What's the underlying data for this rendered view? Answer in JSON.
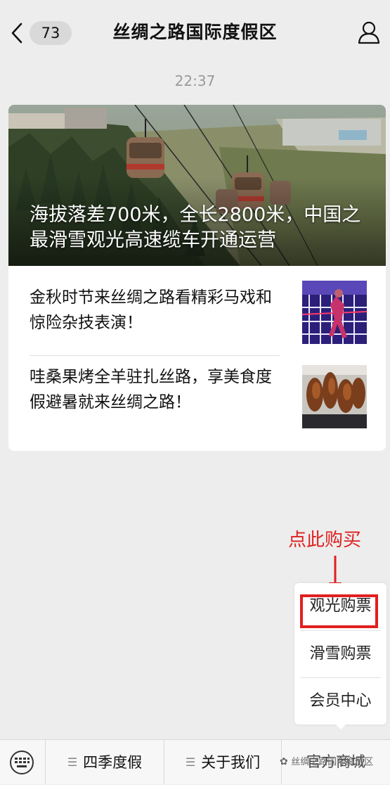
{
  "header": {
    "unread_count": "73",
    "title": "丝绸之路国际度假区"
  },
  "time": "22:37",
  "articles": {
    "main_title": "海拔落差700米，全长2800米，中国之最滑雪观光高速缆车开通运营",
    "items": [
      {
        "title": "金秋时节来丝绸之路看精彩马戏和惊险杂技表演！"
      },
      {
        "title": "哇桑果烤全羊驻扎丝路，享美食度假避暑就来丝绸之路！"
      }
    ]
  },
  "annotation": {
    "text": "点此购买",
    "color": "#e02020"
  },
  "popup_menu": {
    "items": [
      "观光购票",
      "滑雪购票",
      "会员中心"
    ],
    "highlighted_index": 0
  },
  "bottom_menu": {
    "items": [
      "四季度假",
      "关于我们",
      "官方商城"
    ],
    "watermark": "丝绸之路国际度假区"
  }
}
